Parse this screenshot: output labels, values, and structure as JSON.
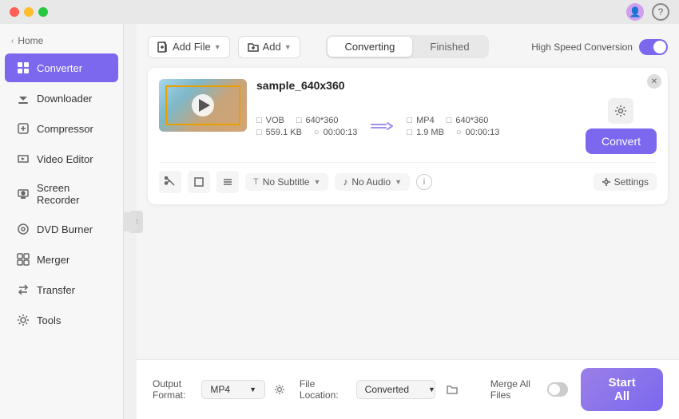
{
  "titlebar": {
    "traffic_lights": [
      "close",
      "minimize",
      "maximize"
    ],
    "user_icon": "👤",
    "help_icon": "?"
  },
  "sidebar": {
    "home_label": "Home",
    "items": [
      {
        "id": "converter",
        "label": "Converter",
        "icon": "▤",
        "active": true
      },
      {
        "id": "downloader",
        "label": "Downloader",
        "icon": "⬇"
      },
      {
        "id": "compressor",
        "label": "Compressor",
        "icon": "⊡"
      },
      {
        "id": "video-editor",
        "label": "Video Editor",
        "icon": "✂"
      },
      {
        "id": "screen-recorder",
        "label": "Screen Recorder",
        "icon": "⊙"
      },
      {
        "id": "dvd-burner",
        "label": "DVD Burner",
        "icon": "⊙"
      },
      {
        "id": "merger",
        "label": "Merger",
        "icon": "⊞"
      },
      {
        "id": "transfer",
        "label": "Transfer",
        "icon": "⇄"
      },
      {
        "id": "tools",
        "label": "Tools",
        "icon": "⚙"
      }
    ]
  },
  "topbar": {
    "add_file_label": "Add File",
    "add_folder_label": "Add",
    "tabs": [
      {
        "id": "converting",
        "label": "Converting",
        "active": true
      },
      {
        "id": "finished",
        "label": "Finished",
        "active": false
      }
    ],
    "speed_label": "High Speed Conversion",
    "toggle_on": true
  },
  "file_card": {
    "filename": "sample_640x360",
    "source": {
      "format": "VOB",
      "resolution": "640*360",
      "size": "559.1 KB",
      "duration": "00:00:13"
    },
    "target": {
      "format": "MP4",
      "resolution": "640*360",
      "size": "1.9 MB",
      "duration": "00:00:13"
    },
    "convert_btn_label": "Convert",
    "subtitle_label": "No Subtitle",
    "audio_label": "No Audio",
    "settings_label": "Settings"
  },
  "bottom": {
    "output_format_label": "Output Format:",
    "output_format_value": "MP4",
    "file_location_label": "File Location:",
    "file_location_value": "Converted",
    "merge_label": "Merge All Files",
    "start_all_label": "Start All"
  }
}
